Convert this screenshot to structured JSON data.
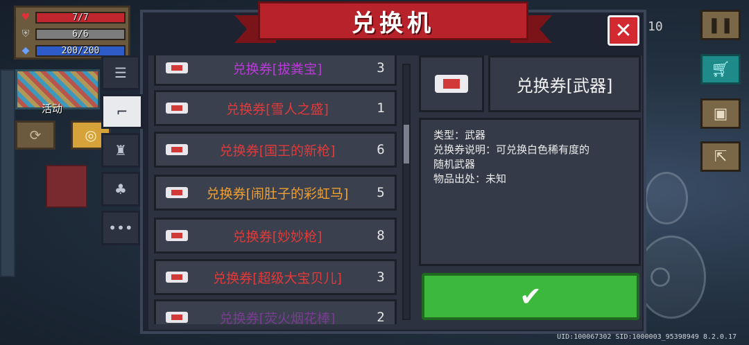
{
  "dialog": {
    "title": "兑换机",
    "close_icon": "close-icon",
    "confirm_icon": "check-icon"
  },
  "hud": {
    "hp": "7/7",
    "armor": "6/6",
    "energy": "200/200",
    "event_label": "活动",
    "coins": "10",
    "uid_line": "UID:100067302 SID:1000003_95398949 8.2.0.17"
  },
  "tabs": [
    {
      "icon": "list-icon",
      "glyph": "☰"
    },
    {
      "icon": "gun-icon",
      "glyph": "⌐"
    },
    {
      "icon": "skin-icon",
      "glyph": "♜"
    },
    {
      "icon": "plant-icon",
      "glyph": "♣"
    },
    {
      "icon": "more-icon",
      "glyph": "•••"
    }
  ],
  "items": [
    {
      "name": "兑换券[拔粪宝]",
      "qty": "3",
      "color": "#b93ad8"
    },
    {
      "name": "兑换券[雪人之盛]",
      "qty": "1",
      "color": "#e23a3a"
    },
    {
      "name": "兑换券[国王的新枪]",
      "qty": "6",
      "color": "#e23a3a"
    },
    {
      "name": "兑换券[闹肚子的彩虹马]",
      "qty": "5",
      "color": "#f0a030"
    },
    {
      "name": "兑换券[妙妙枪]",
      "qty": "8",
      "color": "#e23a3a"
    },
    {
      "name": "兑换券[超级大宝贝儿]",
      "qty": "3",
      "color": "#e23a3a"
    },
    {
      "name": "兑换券[荧火烟花棒]",
      "qty": "2",
      "color": "#b93ad8"
    }
  ],
  "detail": {
    "title": "兑换券[武器]",
    "type_line": "类型：武器",
    "desc_line1": "兑换券说明：可兑换白色稀有度的",
    "desc_line2": "随机武器",
    "source_line": "物品出处：未知"
  }
}
